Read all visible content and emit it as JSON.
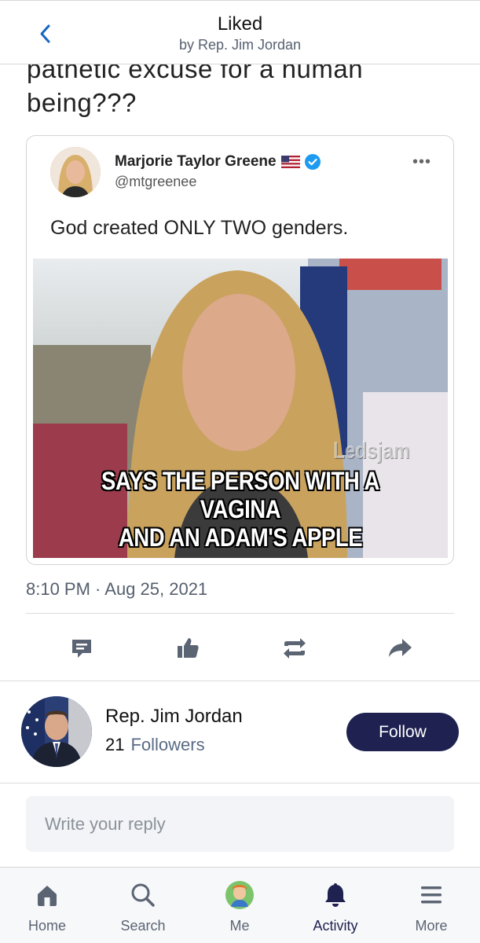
{
  "header": {
    "title": "Liked",
    "subtitle": "by Rep. Jim Jordan"
  },
  "post": {
    "text_line1": "pathetic excuse for a human",
    "text_line2": "being???",
    "timestamp": "8:10 PM · Aug 25, 2021"
  },
  "embedded_tweet": {
    "name": "Marjorie Taylor Greene",
    "handle": "@mtgreenee",
    "body": "God created ONLY TWO genders.",
    "image_caption_line1": "SAYS THE PERSON WITH A VAGINA",
    "image_caption_line2": "AND AN ADAM'S APPLE",
    "image_watermark": "Ledsjam"
  },
  "actions": [
    "comment-icon",
    "like-icon",
    "repost-icon",
    "share-icon"
  ],
  "author": {
    "name": "Rep. Jim Jordan",
    "followers_count": "21",
    "followers_label": "Followers",
    "follow_label": "Follow"
  },
  "reply": {
    "placeholder": "Write your reply"
  },
  "nav": {
    "home": "Home",
    "search": "Search",
    "me": "Me",
    "activity": "Activity",
    "more": "More"
  },
  "colors": {
    "accent": "#1f2150",
    "link": "#1565c0",
    "verified": "#1d9bf0"
  }
}
